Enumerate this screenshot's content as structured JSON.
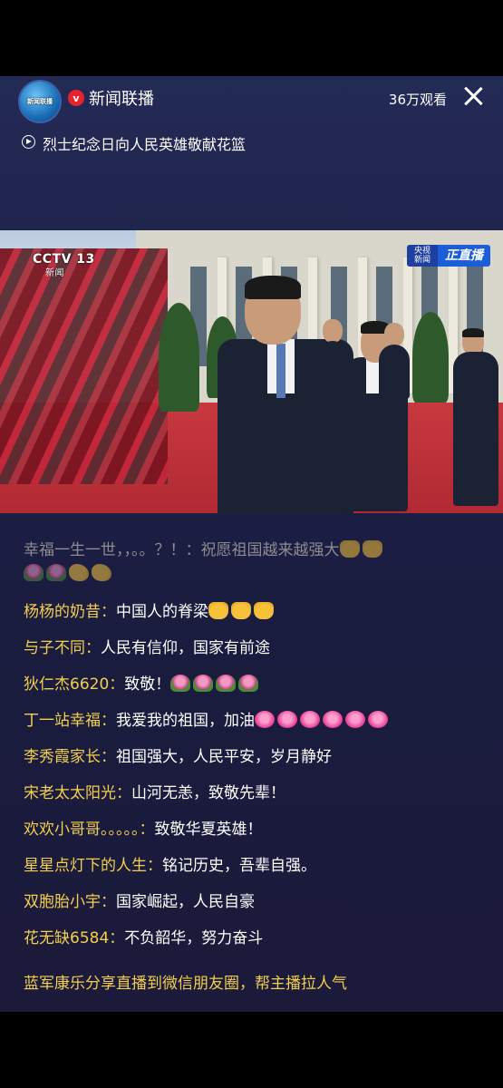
{
  "header": {
    "logo_text": "新闻联播",
    "channel_name": "新闻联播",
    "verified_badge": "v",
    "viewers": "36万观看",
    "subtitle": "烈士纪念日向人民英雄敬献花篮"
  },
  "video": {
    "broadcaster_logo": "CCTV 13",
    "broadcaster_sub": "新闻",
    "live_badge_left": "央视新闻",
    "live_badge_right": "正直播"
  },
  "comments": [
    {
      "user": "幸福一生一世，，。。？！：",
      "message": "祝愿祖国越来越强大",
      "emoji": [
        "thumbs-up-icon",
        "thumbs-up-icon"
      ],
      "faded": true
    },
    {
      "user": "",
      "message": "",
      "emoji": [
        "flower-icon",
        "flower-icon",
        "flexed-arm-icon",
        "flexed-arm-icon"
      ],
      "faded": true
    },
    {
      "user": "杨杨的奶昔：",
      "message": "中国人的脊梁",
      "emoji": [
        "thumbs-up-icon",
        "thumbs-up-icon",
        "thumbs-up-icon"
      ],
      "faded": false
    },
    {
      "user": "与子不同：",
      "message": "人民有信仰，国家有前途",
      "emoji": [],
      "faded": false
    },
    {
      "user": "狄仁杰6620：",
      "message": "致敬！",
      "emoji": [
        "flower-icon",
        "flower-icon",
        "flower-icon",
        "flower-icon"
      ],
      "faded": false
    },
    {
      "user": "丁一站幸福：",
      "message": "我爱我的祖国，加油",
      "emoji": [
        "heart-icon",
        "heart-icon",
        "heart-icon",
        "heart-icon",
        "heart-icon",
        "heart-icon"
      ],
      "faded": false
    },
    {
      "user": "李秀霞家长：",
      "message": "祖国强大，人民平安，岁月静好",
      "emoji": [],
      "faded": false
    },
    {
      "user": "宋老太太阳光：",
      "message": "山河无恙，致敬先辈！",
      "emoji": [],
      "faded": false
    },
    {
      "user": "欢欢小哥哥。。。。。：",
      "message": "致敬华夏英雄！",
      "emoji": [],
      "faded": false
    },
    {
      "user": "星星点灯下的人生：",
      "message": "铭记历史，吾辈自强。",
      "emoji": [],
      "faded": false
    },
    {
      "user": "双胞胎小宇：",
      "message": "国家崛起，人民自豪",
      "emoji": [],
      "faded": false
    },
    {
      "user": "花无缺6584：",
      "message": "不负韶华，努力奋斗",
      "emoji": [],
      "faded": false
    }
  ],
  "share_notice": "蓝军康乐分享直播到微信朋友圈，帮主播拉人气"
}
